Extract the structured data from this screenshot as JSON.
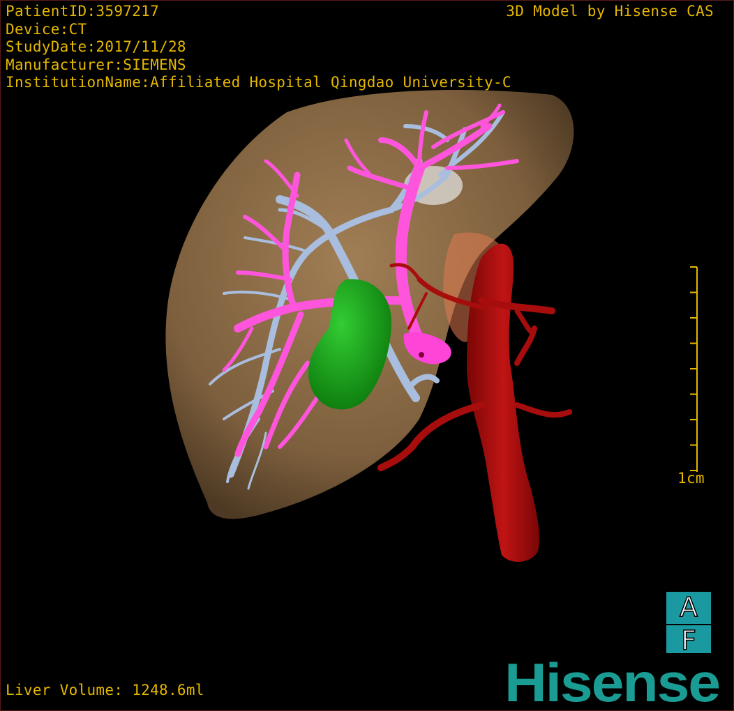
{
  "patient_info": {
    "patient_id": "PatientID:3597217",
    "device": "Device:CT",
    "study_date": "StudyDate:2017/11/28",
    "manufacturer": "Manufacturer:SIEMENS",
    "institution": "InstitutionName:Affiliated Hospital Qingdao University-C"
  },
  "model_credit": "3D Model by Hisense CAS",
  "scale": {
    "label": "1cm",
    "ticks": 9
  },
  "liver_volume": "Liver Volume: 1248.6ml",
  "orientation_cube": {
    "top_face": "A",
    "bottom_face": "F"
  },
  "brand": "Hisense",
  "colors": {
    "overlay_text": "#e6b800",
    "liver": "#8a6a45",
    "portal_vein": "#ff55dd",
    "hepatic_vein": "#a9bedf",
    "tumor": "#1fa51f",
    "aorta": "#b20c0c",
    "brand": "#1a9c94",
    "cube": "#1a9aa0"
  },
  "structures": [
    "liver-surface",
    "portal-vein",
    "hepatic-vein",
    "tumor",
    "artery",
    "vena-cava"
  ]
}
